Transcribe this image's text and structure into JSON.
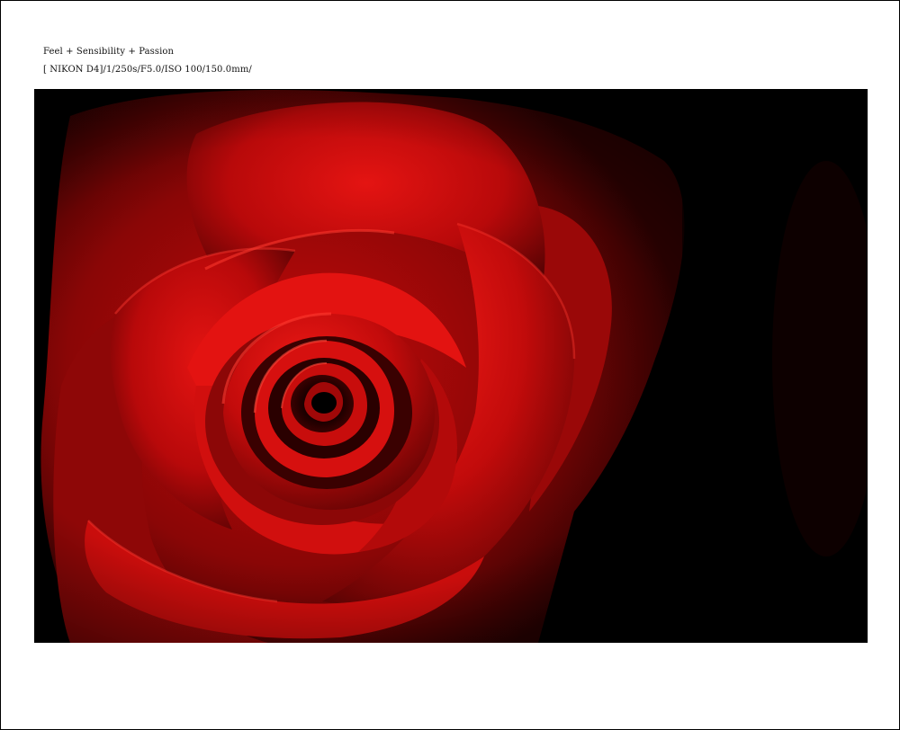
{
  "caption": {
    "title": "Feel + Sensibility + Passion",
    "exif": "[ NIKON D4]/1/250s/F5.0/ISO 100/150.0mm/"
  },
  "photo": {
    "subject": "red-rose",
    "colors": {
      "background": "#000000",
      "petal_bright": "#e0110f",
      "petal_mid": "#b8090a",
      "petal_dark": "#5a0303",
      "shadow": "#1a0000"
    }
  }
}
